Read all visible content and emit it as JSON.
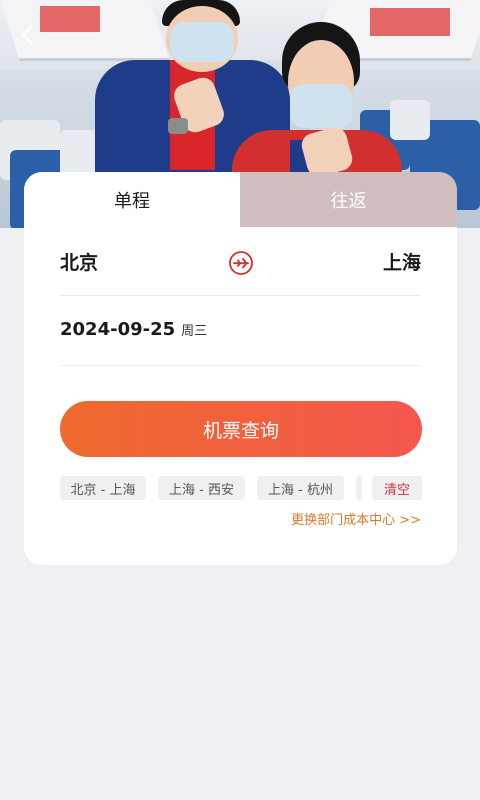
{
  "header": {
    "back_icon": "chevron-left-icon"
  },
  "trip_tabs": [
    {
      "label": "单程",
      "active": true
    },
    {
      "label": "往返",
      "active": false
    }
  ],
  "route": {
    "from": "北京",
    "to": "上海",
    "swap_icon": "plane-swap-icon"
  },
  "date": {
    "value": "2024-09-25",
    "weekday": "周三"
  },
  "search": {
    "label": "机票查询"
  },
  "history": {
    "items": [
      "北京 - 上海",
      "上海 - 西安",
      "上海 - 杭州"
    ],
    "clear_label": "清空"
  },
  "dept_link": "更换部门成本中心 >>",
  "colors": {
    "accent_gradient_start": "#ee6a2d",
    "accent_gradient_end": "#f5574f",
    "brand_red": "#d2302f",
    "link_orange": "#d87a2b",
    "clear_red": "#c8343a"
  }
}
